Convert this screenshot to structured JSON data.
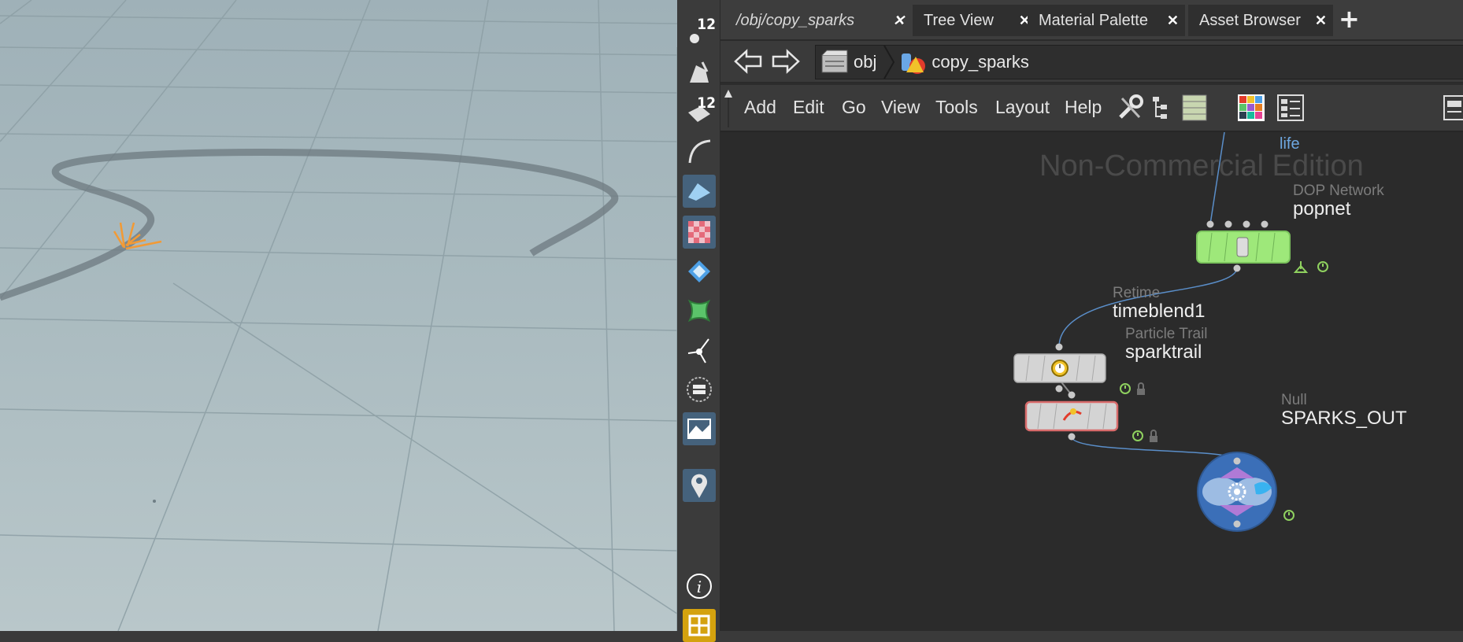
{
  "shelf": {
    "tools": [
      {
        "name": "points-count",
        "badge": "12"
      },
      {
        "name": "paint-bucket"
      },
      {
        "name": "prims-count",
        "badge": "12"
      },
      {
        "name": "curve"
      },
      {
        "name": "plane"
      },
      {
        "name": "checker"
      },
      {
        "name": "diamond-plane"
      },
      {
        "name": "green-shape"
      },
      {
        "name": "light-handle"
      },
      {
        "name": "circle-list"
      },
      {
        "name": "landscape"
      },
      {
        "name": "pin"
      },
      {
        "name": "info"
      },
      {
        "name": "grid-quad"
      }
    ]
  },
  "tabs": [
    {
      "label": "/obj/copy_sparks",
      "close": "✕"
    },
    {
      "label": "Tree View",
      "close": "✕"
    },
    {
      "label": "Material Palette",
      "close": "✕"
    },
    {
      "label": "Asset Browser",
      "close": "✕"
    }
  ],
  "add_tab": "+",
  "path": {
    "crumbs": [
      {
        "label": "obj"
      },
      {
        "label": "copy_sparks"
      }
    ]
  },
  "menu": [
    "Add",
    "Edit",
    "Go",
    "View",
    "Tools",
    "Layout",
    "Help"
  ],
  "network": {
    "watermark": "Non-Commercial Edition",
    "incoming_label": "life",
    "nodes": [
      {
        "type": "DOP Network",
        "name": "popnet"
      },
      {
        "type": "Retime",
        "name": "timeblend1"
      },
      {
        "type": "Particle Trail",
        "name": "sparktrail"
      },
      {
        "type": "Null",
        "name": "SPARKS_OUT"
      }
    ]
  },
  "colors": {
    "dop_node": "#9ee87a",
    "null_node": "#3b6fb8",
    "wire": "#5a8ec9",
    "selected_border": "#d86b6b"
  }
}
